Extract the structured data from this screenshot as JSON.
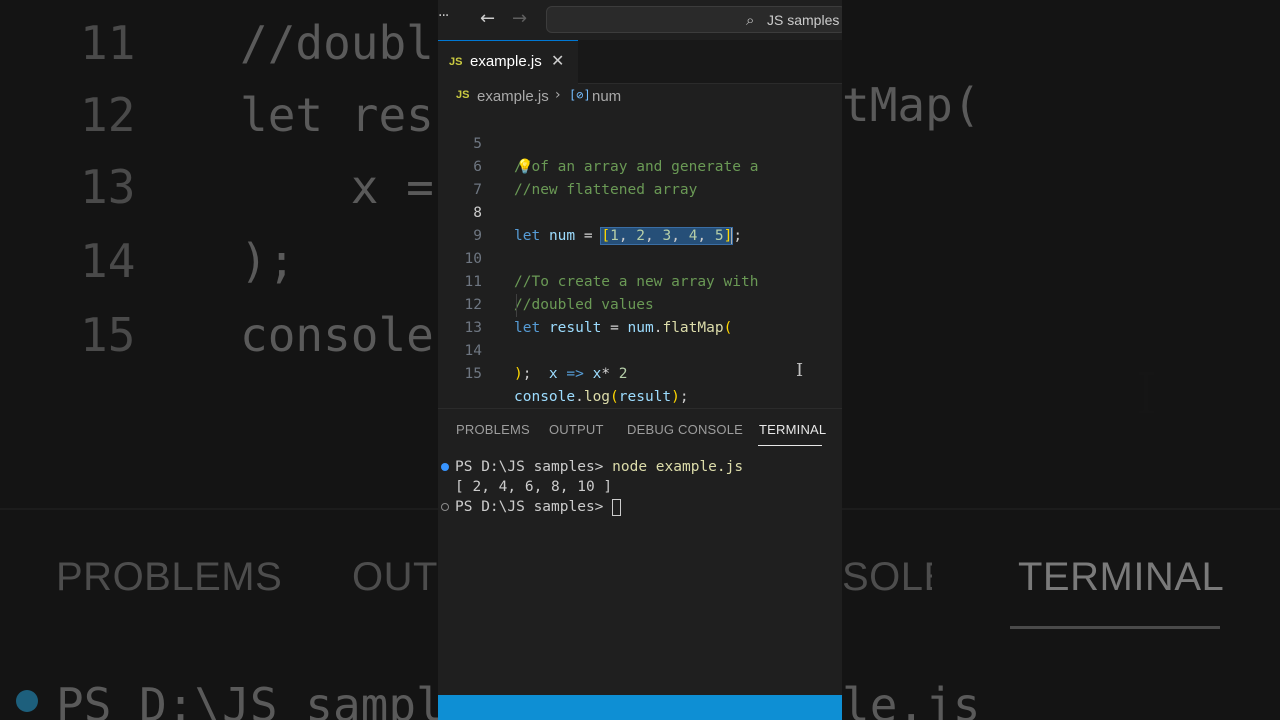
{
  "background": {
    "code_lines": [
      {
        "num": "11",
        "text": "//doubl"
      },
      {
        "num": "12",
        "text": "let res"
      },
      {
        "num": "13",
        "text": "    x ="
      },
      {
        "num": "14",
        "text": ");"
      },
      {
        "num": "15",
        "text": "console"
      }
    ],
    "right_text": "tMap(",
    "panel_tabs": [
      "PROBLEMS",
      "OUTI",
      "SOLE",
      "TERMINAL"
    ],
    "terminal_left": "PS D:\\JS sampl",
    "terminal_right": "le.js"
  },
  "titlebar": {
    "menu_glyph": "···",
    "back_glyph": "←",
    "forward_glyph": "→",
    "search_icon": "search-icon",
    "search_text": "JS samples"
  },
  "tab": {
    "badge": "JS",
    "label": "example.js",
    "close_glyph": "✕"
  },
  "breadcrumb": {
    "badge": "JS",
    "file": "example.js",
    "separator": "›",
    "symbol_icon": "[⊘]",
    "symbol": "num"
  },
  "editor": {
    "lines": [
      "5",
      "6",
      "7",
      "8",
      "9",
      "10",
      "11",
      "12",
      "13",
      "14",
      "15"
    ],
    "current_line": "8",
    "c5": "//of an array and generate a",
    "c6": "//new flattened array",
    "c8": {
      "kw": "let",
      "var": "num",
      "eq": "=",
      "open": "[",
      "v1": "1",
      "v2": "2",
      "v3": "3",
      "v4": "4",
      "v5": "5",
      "close": "]",
      "semi": ";"
    },
    "c10": "//To create a new array with",
    "c11": "//doubled values",
    "c12": {
      "kw": "let",
      "var": "result",
      "eq": "=",
      "obj": "num",
      "fn": "flatMap",
      "open": "("
    },
    "c13": {
      "param": "x",
      "arrow": "=>",
      "var": "x",
      "op": "*",
      "num": "2"
    },
    "c14": {
      "close": ")",
      "semi": ";"
    },
    "c15": {
      "obj": "console",
      "fn": "log",
      "open": "(",
      "arg": "result",
      "close": ")",
      "semi": ";"
    }
  },
  "panel": {
    "tabs": [
      "PROBLEMS",
      "OUTPUT",
      "DEBUG CONSOLE",
      "TERMINAL"
    ],
    "active_tab": "TERMINAL"
  },
  "terminal": {
    "prompt": "PS D:\\JS samples>",
    "command": "node example.js",
    "output": "[ 2, 4, 6, 8, 10 ]"
  },
  "colors": {
    "accent": "#0078d4",
    "statusbar": "#0e8fd4",
    "keyword": "#569cd6",
    "comment": "#6a9955",
    "function": "#dcdcaa",
    "bracket": "#ffd700"
  }
}
